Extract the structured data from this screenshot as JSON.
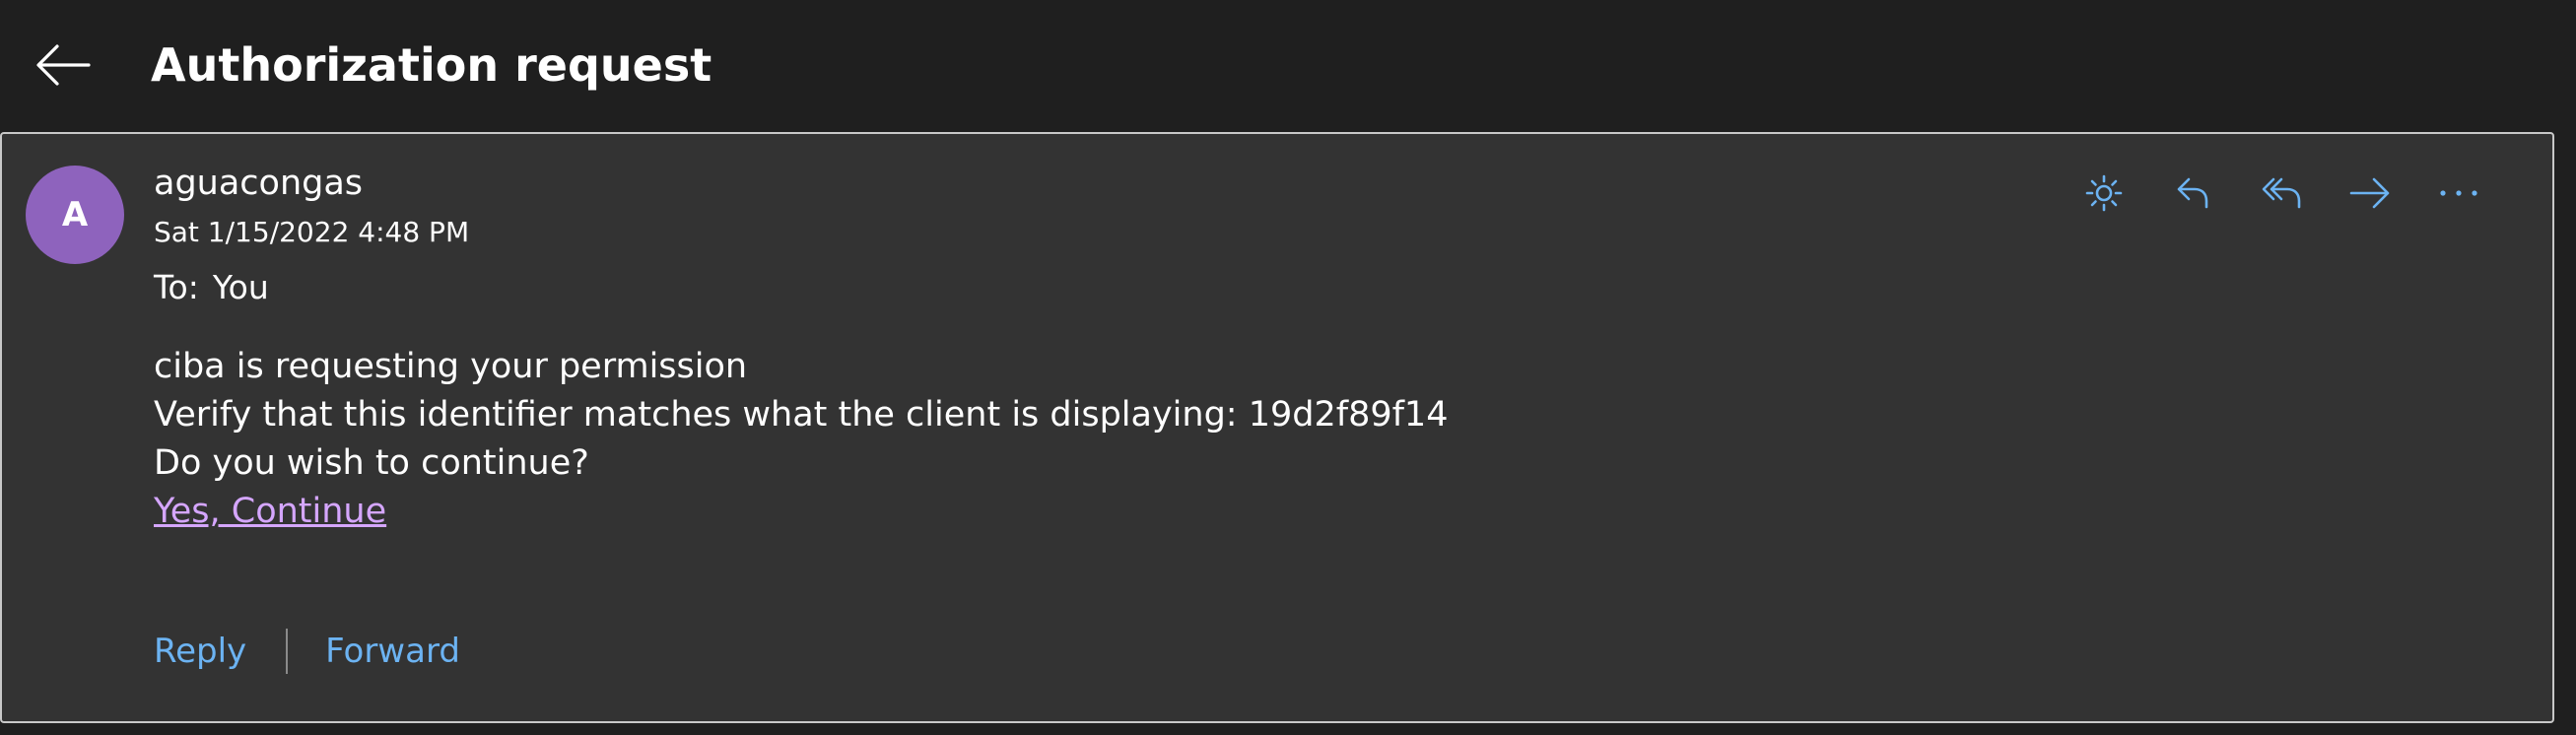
{
  "header": {
    "title": "Authorization request",
    "back_icon": "arrow-left-icon"
  },
  "message": {
    "avatar_initial": "A",
    "avatar_color": "#8e63bd",
    "sender": "aguacongas",
    "date": "Sat 1/15/2022 4:48 PM",
    "to_label": "To:",
    "to_value": "You",
    "body": {
      "line1": "ciba is requesting your permission",
      "line2": "Verify that this identifier matches what the client is displaying: 19d2f89f14",
      "line3": "Do you wish to continue?",
      "link": "Yes, Continue"
    },
    "link_color": "#d5a6ff"
  },
  "toolbar": {
    "icons": [
      "sun-icon",
      "reply-icon",
      "reply-all-icon",
      "forward-icon",
      "more-icon"
    ],
    "accent": "#6cb3f2"
  },
  "footer": {
    "reply_label": "Reply",
    "forward_label": "Forward"
  }
}
